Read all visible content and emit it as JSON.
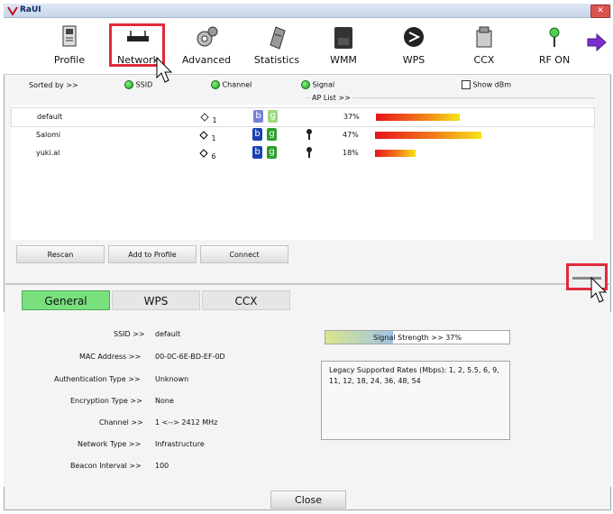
{
  "window": {
    "title": "RaUI",
    "close_glyph": "✕"
  },
  "toolbar": [
    {
      "label": "Profile",
      "icon": "profile-icon"
    },
    {
      "label": "Network",
      "icon": "network-icon"
    },
    {
      "label": "Advanced",
      "icon": "advanced-icon"
    },
    {
      "label": "Statistics",
      "icon": "statistics-icon"
    },
    {
      "label": "WMM",
      "icon": "wmm-icon"
    },
    {
      "label": "WPS",
      "icon": "wps-icon"
    },
    {
      "label": "CCX",
      "icon": "ccx-icon"
    },
    {
      "label": "RF ON",
      "icon": "rf-on-icon"
    }
  ],
  "sort": {
    "label": "Sorted by >>",
    "ssid": "SSID",
    "channel": "Channel",
    "signal": "Signal",
    "show_dbm": "Show dBm",
    "ap_list": "AP List >>"
  },
  "ap_list": [
    {
      "ssid": "default",
      "channel": "1",
      "b": "b",
      "g": "g",
      "secured": false,
      "signal_pct": 37,
      "signal": "37%"
    },
    {
      "ssid": "Salomi",
      "channel": "1",
      "b": "b",
      "g": "g",
      "secured": true,
      "signal_pct": 47,
      "signal": "47%"
    },
    {
      "ssid": "yuki.al",
      "channel": "6",
      "b": "b",
      "g": "g",
      "secured": true,
      "signal_pct": 18,
      "signal": "18%"
    }
  ],
  "buttons": {
    "rescan": "Rescan",
    "add_to_profile": "Add to Profile",
    "connect": "Connect"
  },
  "tabs": {
    "general": "General",
    "wps": "WPS",
    "ccx": "CCX"
  },
  "details": {
    "ssid_label": "SSID >>",
    "ssid": "default",
    "mac_label": "MAC Address >>",
    "mac": "00-0C-6E-BD-EF-0D",
    "auth_label": "Authentication Type >>",
    "auth": "Unknown",
    "enc_label": "Encryption Type >>",
    "enc": "None",
    "channel_label": "Channel >>",
    "channel": "1 <--> 2412 MHz",
    "nettype_label": "Network Type >>",
    "nettype": "Infrastructure",
    "beacon_label": "Beacon Interval >>",
    "beacon": "100",
    "signal_strength": "Signal Strength >> 37%",
    "signal_strength_pct": 37,
    "rates": "Legacy Supported Rates (Mbps): 1, 2, 5.5, 6, 9, 11, 12, 18, 24, 36, 48, 54"
  },
  "close_label": "Close",
  "colors": {
    "highlight": "#e12a3b",
    "tab_active": "#79e07e"
  }
}
